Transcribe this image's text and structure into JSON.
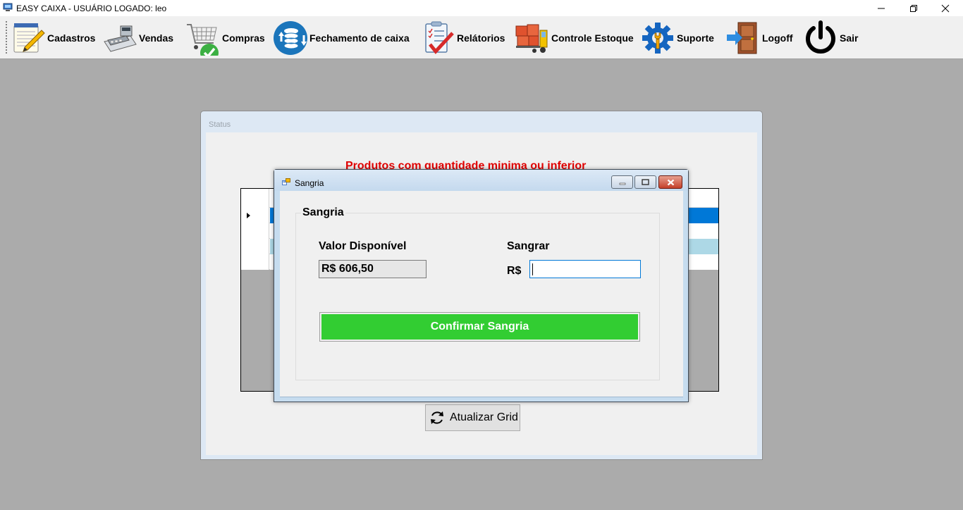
{
  "window": {
    "title": "EASY CAIXA - USUÁRIO LOGADO: leo"
  },
  "toolbar": {
    "items": [
      {
        "label": "Cadastros",
        "icon": "notepad-pencil-icon"
      },
      {
        "label": "Vendas",
        "icon": "cash-register-icon"
      },
      {
        "label": "Compras",
        "icon": "shopping-cart-check-icon"
      },
      {
        "label": "Fechamento de caixa",
        "icon": "coins-exchange-icon"
      },
      {
        "label": "Relátorios",
        "icon": "checklist-icon"
      },
      {
        "label": "Controle Estoque",
        "icon": "forklift-boxes-icon"
      },
      {
        "label": "Suporte",
        "icon": "gear-wrench-icon"
      },
      {
        "label": "Logoff",
        "icon": "door-exit-icon"
      },
      {
        "label": "Sair",
        "icon": "power-icon"
      }
    ]
  },
  "status_window": {
    "title": "Status",
    "heading": "Produtos com quantidade minima ou inferior",
    "grid": {
      "row_colors": [
        "#0078d7",
        "#ffffff",
        "#add8e6",
        "#ffffff"
      ]
    },
    "refresh_button": "Atualizar Grid"
  },
  "dialog": {
    "title": "Sangria",
    "group_title": "Sangria",
    "valor_label": "Valor Disponível",
    "valor_value": "R$ 606,50",
    "sangrar_label": "Sangrar",
    "currency_label": "R$",
    "sangrar_input_value": "",
    "confirm_button": "Confirmar Sangria"
  },
  "colors": {
    "confirm_green": "#32cd32",
    "heading_red": "#e00000",
    "selection_blue": "#0078d7"
  }
}
